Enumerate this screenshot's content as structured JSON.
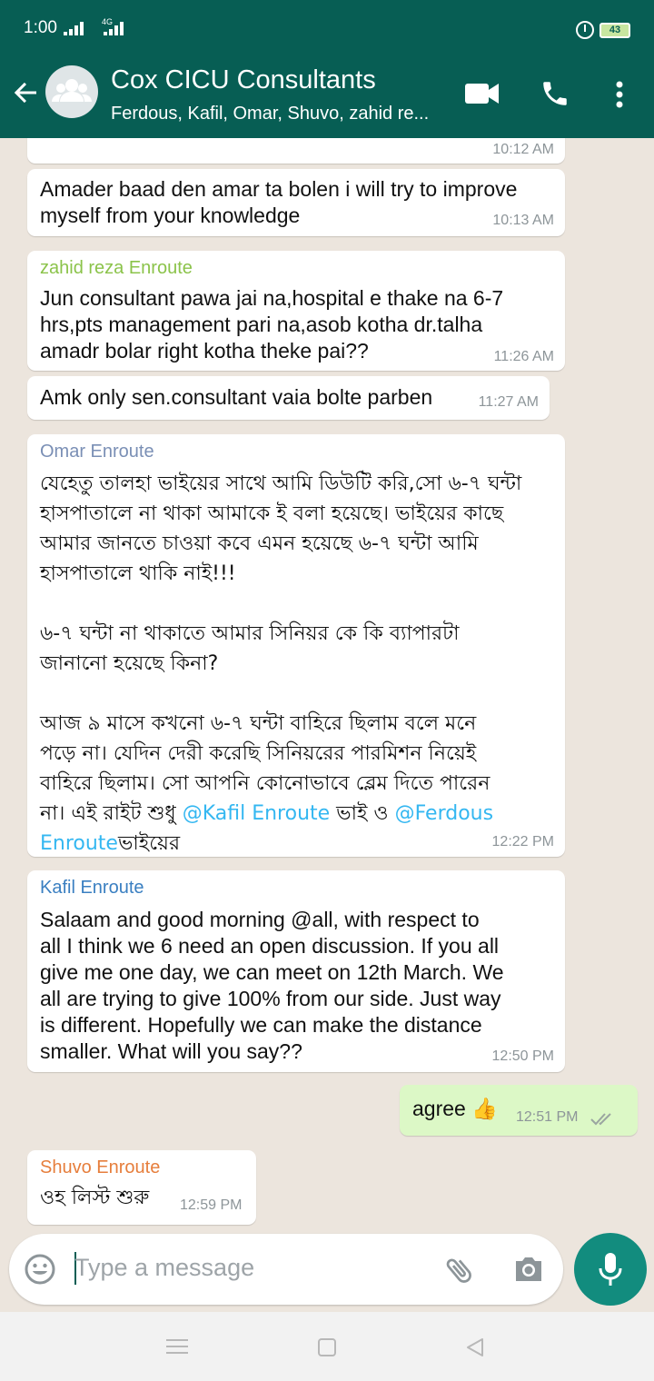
{
  "status_bar": {
    "time": "1:00",
    "network": "4G",
    "battery": "43"
  },
  "header": {
    "title": "Cox CICU Consultants",
    "subtitle": "Ferdous, Kafil, Omar, Shuvo, zahid re..."
  },
  "colors": {
    "header": "#075e54",
    "accent": "#128c7e",
    "outgoing": "#dcf8c6",
    "mention": "#34b7f1"
  },
  "messages": [
    {
      "time": "10:12 AM"
    },
    {
      "text": "Amader baad den amar ta bolen i will try to improve\nmyself from your knowledge",
      "time": "10:13 AM"
    },
    {
      "sender": "zahid reza Enroute",
      "sender_color": "#8bc34a",
      "text": "Jun consultant pawa jai na,hospital e thake na 6-7\nhrs,pts management pari na,asob kotha dr.talha\namadr bolar right kotha theke pai??",
      "time": "11:26 AM"
    },
    {
      "text": "Amk only sen.consultant vaia bolte parben",
      "time": "11:27 AM"
    },
    {
      "sender": "Omar Enroute",
      "sender_color": "#7a8fb5",
      "text_part1": "যেহেতু তালহা ভাইয়ের সাথে আমি ডিউটি করি,সো ৬-৭ ঘন্টা\nহাসপাতালে না থাকা আমাকে ই বলা হয়েছে। ভাইয়ের কাছে\nআমার জানতে চাওয়া কবে এমন হয়েছে ৬-৭ ঘন্টা আমি\nহাসপাতালে থাকি নাই!!!\n\n৬-৭ ঘন্টা না থাকাতে আমার সিনিয়র কে কি ব্যাপারটা\nজানানো হয়েছে কিনা?\n\nআজ ৯ মাসে কখনো ৬-৭ ঘন্টা বাহিরে ছিলাম বলে মনে\nপড়ে না। যেদিন দেরী করেছি সিনিয়রের পারমিশন নিয়েই\nবাহিরে ছিলাম। সো আপনি কোনোভাবে ব্লেম দিতে পারেন\nনা। এই রাইট শুধু ",
      "mention1": "@Kafil Enroute",
      "text_part2": " ভাই ও ",
      "mention2": "@Ferdous\nEnroute",
      "text_part3": "ভাইয়ের",
      "time": "12:22 PM"
    },
    {
      "sender": "Kafil Enroute",
      "sender_color": "#3a7fc1",
      "text": "Salaam and good morning @all, with respect to\nall I think we 6 need an open discussion. If you all\ngive me one day, we can meet on 12th March. We\nall are trying to give 100% from our side. Just way\nis different. Hopefully we can make the distance\nsmaller. What will you say??",
      "time": "12:50 PM"
    },
    {
      "text": "agree 👍",
      "time": "12:51 PM",
      "outgoing": true
    },
    {
      "sender": "Shuvo Enroute",
      "sender_color": "#e67e3c",
      "text": "ওহ লিস্ট শুরু",
      "time": "12:59 PM"
    }
  ],
  "input": {
    "placeholder": "Type a message"
  }
}
